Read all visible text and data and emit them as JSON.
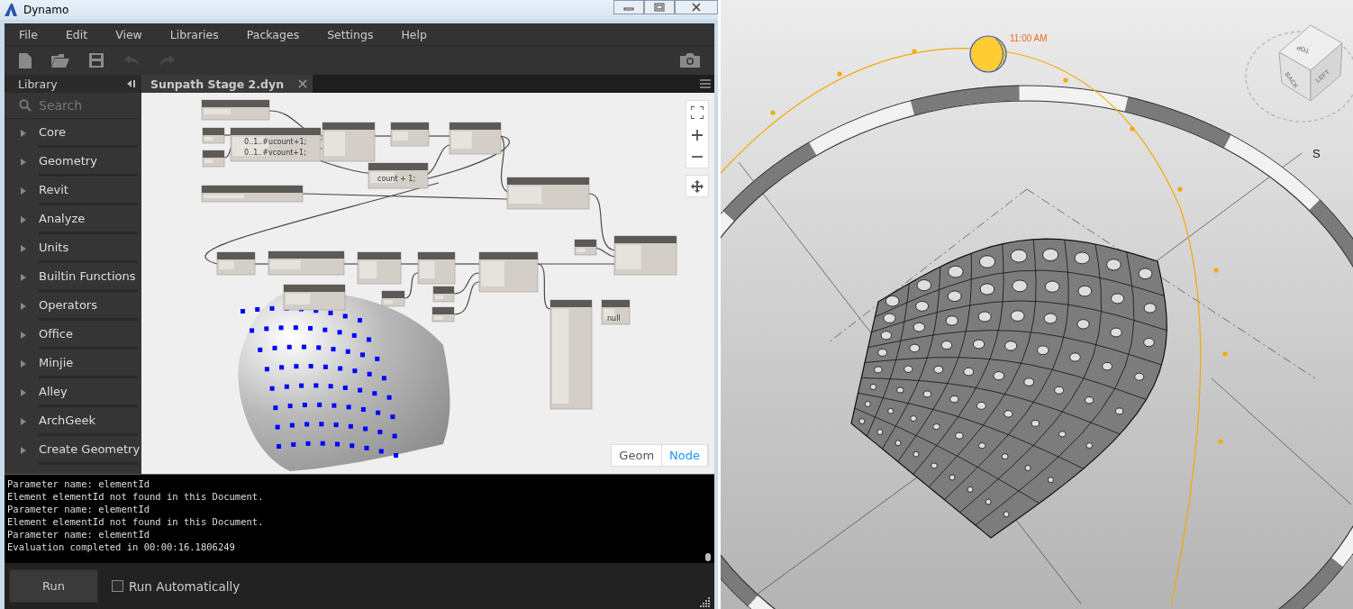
{
  "window": {
    "title": "Dynamo"
  },
  "menu": [
    "File",
    "Edit",
    "View",
    "Libraries",
    "Packages",
    "Settings",
    "Help"
  ],
  "library": {
    "title": "Library",
    "search": {
      "placeholder": "Search"
    },
    "items": [
      "Core",
      "Geometry",
      "Revit",
      "Analyze",
      "Units",
      "Builtin Functions",
      "Operators",
      "Office",
      "Minjie",
      "Alley",
      "ArchGeek",
      "Create Geometry"
    ]
  },
  "tabs": [
    {
      "label": "Sunpath Stage 2.dyn",
      "selected": true
    }
  ],
  "canvas": {
    "code_lines": [
      "0..1..#ucount+1;",
      "0..1..#vcount+1;",
      "count + 1;"
    ],
    "watch_value": "null",
    "view_toggle": [
      {
        "label": "Geom",
        "selected": false
      },
      {
        "label": "Node",
        "selected": true
      }
    ]
  },
  "console": {
    "lines": [
      "Parameter name: elementId",
      "Element elementId not found in this Document.",
      "Parameter name: elementId",
      "Element elementId not found in this Document.",
      "Parameter name: elementId",
      "Evaluation completed in 00:00:16.1806249"
    ]
  },
  "run": {
    "button": "Run",
    "auto": {
      "label": "Run Automatically",
      "checked": false
    }
  },
  "viewport": {
    "sun_time": "11:00 AM",
    "compass_label": "S",
    "viewcube": [
      "TOP",
      "BACK",
      "LEFT"
    ]
  }
}
